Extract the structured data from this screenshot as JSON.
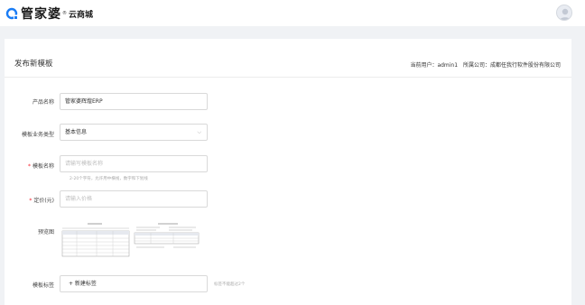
{
  "brand": {
    "name": "管家婆",
    "sub": "云商城",
    "sup": "®",
    "accent": "#1a7cf5"
  },
  "page": {
    "title": "发布新模板",
    "current_user_label": "当前用户：admin1",
    "company_label": "所属公司：成都任我行软件股份有限公司"
  },
  "form": {
    "product_name": {
      "label": "产品名称",
      "value": "管家婆辉煌ERP"
    },
    "business_type": {
      "label": "模板业务类型",
      "value": "基本信息"
    },
    "template_name": {
      "label": "模板名称",
      "required": "*",
      "placeholder": "请输写模板名称",
      "hint": "2-20个字符，允许用中横线，数字和下划线"
    },
    "price": {
      "label": "定价(元)",
      "required": "*",
      "placeholder": "请输入价格"
    },
    "preview": {
      "label": "预览图"
    },
    "tags": {
      "label": "模板标签",
      "add_label": "+ 新建标签",
      "hint": "标签不能超过2个"
    }
  }
}
